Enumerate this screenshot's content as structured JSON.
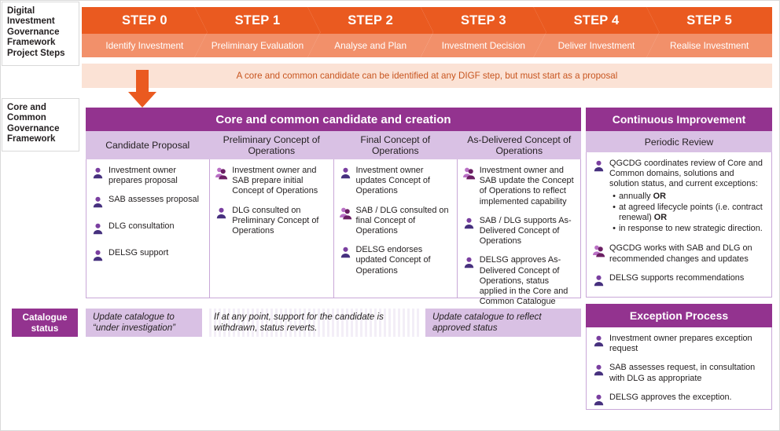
{
  "framework_title": {
    "lines": [
      "Digital",
      "Investment",
      "Governance",
      "Framework",
      "Project Steps"
    ]
  },
  "steps": [
    {
      "number": "STEP 0",
      "label": "Identify Investment"
    },
    {
      "number": "STEP 1",
      "label": "Preliminary Evaluation"
    },
    {
      "number": "STEP 2",
      "label": "Analyse and Plan"
    },
    {
      "number": "STEP 3",
      "label": "Investment Decision"
    },
    {
      "number": "STEP 4",
      "label": "Deliver Investment"
    },
    {
      "number": "STEP 5",
      "label": "Realise Investment"
    }
  ],
  "note_banner": "A core and common candidate can be identified at any DIGF step, but must start as a proposal",
  "left_label": {
    "lines": [
      "Core and",
      "Common",
      "Governance",
      "Framework"
    ]
  },
  "main_panel": {
    "header": "Core and common candidate and creation",
    "columns": [
      {
        "header": "Candidate Proposal",
        "items": [
          {
            "icon": "person-icon",
            "text": "Investment owner prepares proposal"
          },
          {
            "icon": "person-icon",
            "text": "SAB assesses proposal"
          },
          {
            "icon": "person-icon",
            "text": "DLG consultation"
          },
          {
            "icon": "person-icon",
            "text": "DELSG support"
          }
        ]
      },
      {
        "header": "Preliminary Concept of Operations",
        "items": [
          {
            "icon": "two-people-icon",
            "text": "Investment owner and SAB prepare initial Concept of Operations"
          },
          {
            "icon": "person-icon",
            "text": "DLG consulted on Preliminary Concept of Operations"
          }
        ]
      },
      {
        "header": "Final Concept of Operations",
        "items": [
          {
            "icon": "person-icon",
            "text": "Investment owner updates Concept of Operations"
          },
          {
            "icon": "two-people-icon",
            "text": "SAB / DLG consulted on final Concept of Operations"
          },
          {
            "icon": "person-icon",
            "text": "DELSG endorses updated Concept of Operations"
          }
        ]
      },
      {
        "header": "As-Delivered Concept of Operations",
        "items": [
          {
            "icon": "two-people-icon",
            "text": "Investment owner and SAB update the Concept of Operations to reflect implemented capability"
          },
          {
            "icon": "person-icon",
            "text": "SAB / DLG supports As-Delivered Concept of Operations"
          },
          {
            "icon": "person-icon",
            "text": "DELSG approves As-Delivered Concept of Operations, status applied in the Core and Common Catalogue"
          }
        ]
      }
    ]
  },
  "continuous_improvement": {
    "header": "Continuous Improvement",
    "subheader": "Periodic Review",
    "items": [
      {
        "icon": "person-icon",
        "text": "QGCDG coordinates review of Core and Common domains, solutions and solution status, and current exceptions:",
        "sub_items": [
          "annually OR",
          "at agreed lifecycle points (i.e. contract renewal)  OR",
          "in response to new strategic direction."
        ],
        "sub_bold": [
          "OR",
          "OR",
          ""
        ]
      },
      {
        "icon": "two-people-icon",
        "text": "QGCDG works with SAB and DLG on recommended changes and updates"
      },
      {
        "icon": "person-icon",
        "text": "DELSG supports recommendations"
      }
    ]
  },
  "exception_process": {
    "header": "Exception Process",
    "items": [
      {
        "icon": "person-icon",
        "text": "Investment owner prepares exception request"
      },
      {
        "icon": "person-icon",
        "text": "SAB assesses request, in consultation with DLG as appropriate"
      },
      {
        "icon": "person-icon",
        "text": "DELSG approves the exception."
      }
    ]
  },
  "catalogue_status": {
    "label": "Catalogue status",
    "cells": [
      "Update catalogue to “under investigation”",
      "If at any point, support for the candidate is withdrawn, status reverts.",
      "Update catalogue to reflect approved status"
    ]
  },
  "colors": {
    "orange_dark": "#ea5a20",
    "orange_light": "#f2906a",
    "banner_bg": "#fbe2d5",
    "banner_text": "#c8551f",
    "purple": "#93338f",
    "lilac": "#d9c1e4",
    "border": "#c9a8d8"
  }
}
